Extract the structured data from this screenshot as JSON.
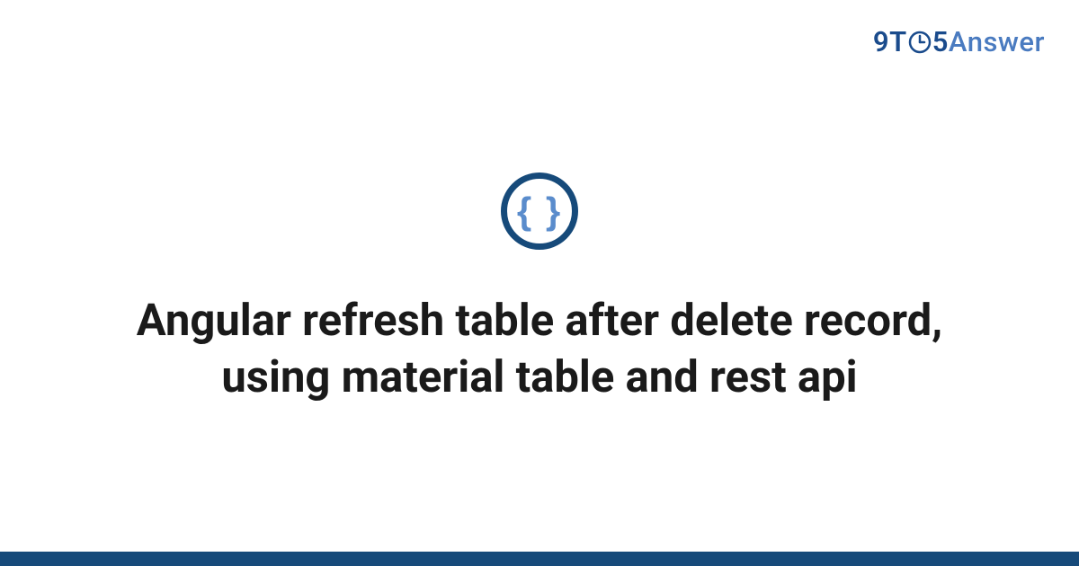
{
  "logo": {
    "part1": "9",
    "part2": "T",
    "part3": "5",
    "part4": "Answer"
  },
  "icon": {
    "name": "code-braces",
    "glyph": "{ }"
  },
  "title": "Angular refresh table after delete record, using material table and rest api",
  "colors": {
    "primary_dark": "#164a7a",
    "primary_light": "#4a7bc0",
    "text": "#1a1a1a"
  }
}
